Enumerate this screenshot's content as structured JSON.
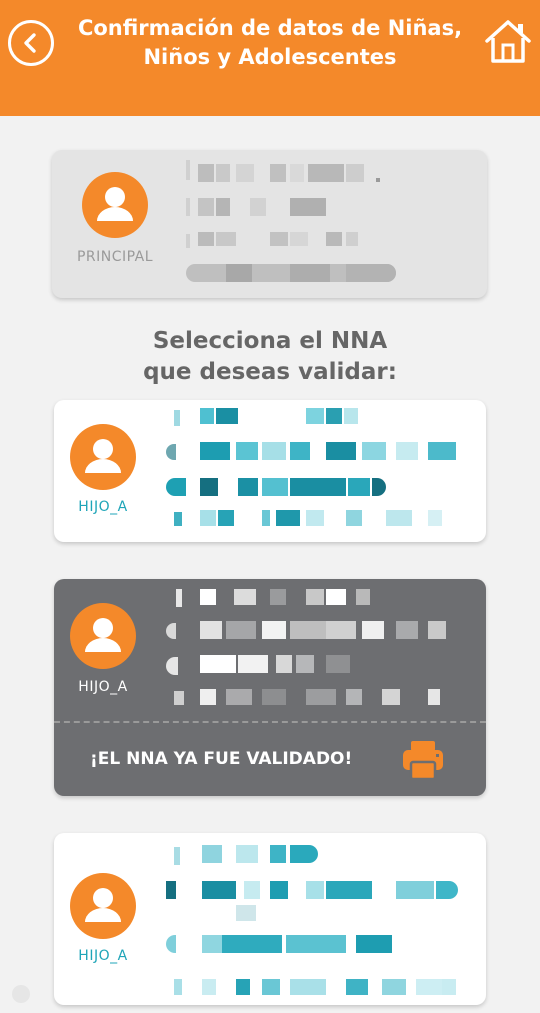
{
  "header": {
    "title_line1": "Confirmación de datos de Niñas,",
    "title_line2": "Niños y Adolescentes"
  },
  "principal": {
    "role": "PRINCIPAL"
  },
  "section": {
    "title_line1": "Selecciona el NNA",
    "title_line2": "que deseas validar:"
  },
  "children": [
    {
      "role": "HIJO_A",
      "validated": false
    },
    {
      "role": "HIJO_A",
      "validated": true,
      "validated_label": "¡EL NNA YA FUE VALIDADO!"
    },
    {
      "role": "HIJO_A",
      "validated": false
    }
  ],
  "colors": {
    "brand_orange": "#f4892a",
    "teal": "#1fa5b8",
    "dark_card": "#6d6e71",
    "principal_card": "#e4e4e4"
  },
  "icons": [
    "back-arrow-icon",
    "home-icon",
    "user-avatar-icon",
    "printer-icon"
  ]
}
